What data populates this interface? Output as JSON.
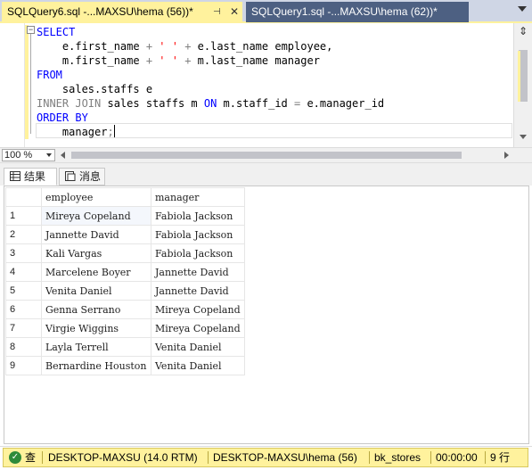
{
  "tabs": [
    {
      "label": "SQLQuery6.sql -...MAXSU\\hema (56))*",
      "pin": "⊣",
      "close": "✕"
    },
    {
      "label": "SQLQuery1.sql -...MAXSU\\hema (62))*"
    }
  ],
  "editor": {
    "lines": [
      [
        {
          "t": "SELECT",
          "c": "kw"
        }
      ],
      [
        {
          "t": "    e.first_name ",
          "c": "ident"
        },
        {
          "t": "+ ",
          "c": "gray"
        },
        {
          "t": "' '",
          "c": "red"
        },
        {
          "t": " + ",
          "c": "gray"
        },
        {
          "t": "e.last_name employee,",
          "c": "ident"
        }
      ],
      [
        {
          "t": "    m.first_name ",
          "c": "ident"
        },
        {
          "t": "+ ",
          "c": "gray"
        },
        {
          "t": "' '",
          "c": "red"
        },
        {
          "t": " + ",
          "c": "gray"
        },
        {
          "t": "m.last_name manager",
          "c": "ident"
        }
      ],
      [
        {
          "t": "FROM",
          "c": "kw"
        }
      ],
      [
        {
          "t": "    sales.staffs e",
          "c": "ident"
        }
      ],
      [
        {
          "t": "INNER JOIN",
          "c": "gray"
        },
        {
          "t": " sales staffs m ",
          "c": "ident"
        },
        {
          "t": "ON",
          "c": "kw"
        },
        {
          "t": " m.staff_id ",
          "c": "ident"
        },
        {
          "t": "=",
          "c": "gray"
        },
        {
          "t": " e.manager_id",
          "c": "ident"
        }
      ],
      [
        {
          "t": "ORDER BY",
          "c": "kw"
        }
      ],
      [
        {
          "t": "    manager",
          "c": "ident"
        },
        {
          "t": ";",
          "c": "gray"
        }
      ]
    ]
  },
  "zoom": "100 %",
  "results_tabs": {
    "results": "结果",
    "messages": "消息"
  },
  "grid": {
    "columns": [
      "employee",
      "manager"
    ],
    "rows": [
      {
        "n": "1",
        "employee": "Mireya Copeland",
        "manager": "Fabiola Jackson"
      },
      {
        "n": "2",
        "employee": "Jannette David",
        "manager": "Fabiola Jackson"
      },
      {
        "n": "3",
        "employee": "Kali Vargas",
        "manager": "Fabiola Jackson"
      },
      {
        "n": "4",
        "employee": "Marcelene Boyer",
        "manager": "Jannette David"
      },
      {
        "n": "5",
        "employee": "Venita Daniel",
        "manager": "Jannette David"
      },
      {
        "n": "6",
        "employee": "Genna Serrano",
        "manager": "Mireya Copeland"
      },
      {
        "n": "7",
        "employee": "Virgie Wiggins",
        "manager": "Mireya Copeland"
      },
      {
        "n": "8",
        "employee": "Layla Terrell",
        "manager": "Venita Daniel"
      },
      {
        "n": "9",
        "employee": "Bernardine Houston",
        "manager": "Venita Daniel"
      }
    ]
  },
  "status": {
    "state": "查",
    "server": "DESKTOP-MAXSU (14.0 RTM)",
    "user": "DESKTOP-MAXSU\\hema (56)",
    "database": "bk_stores",
    "elapsed": "00:00:00",
    "rows": "9 行"
  },
  "colors": {
    "accent": "#fff29d",
    "keyword": "#0000ff",
    "string": "#ff0000",
    "operator": "#808080"
  }
}
